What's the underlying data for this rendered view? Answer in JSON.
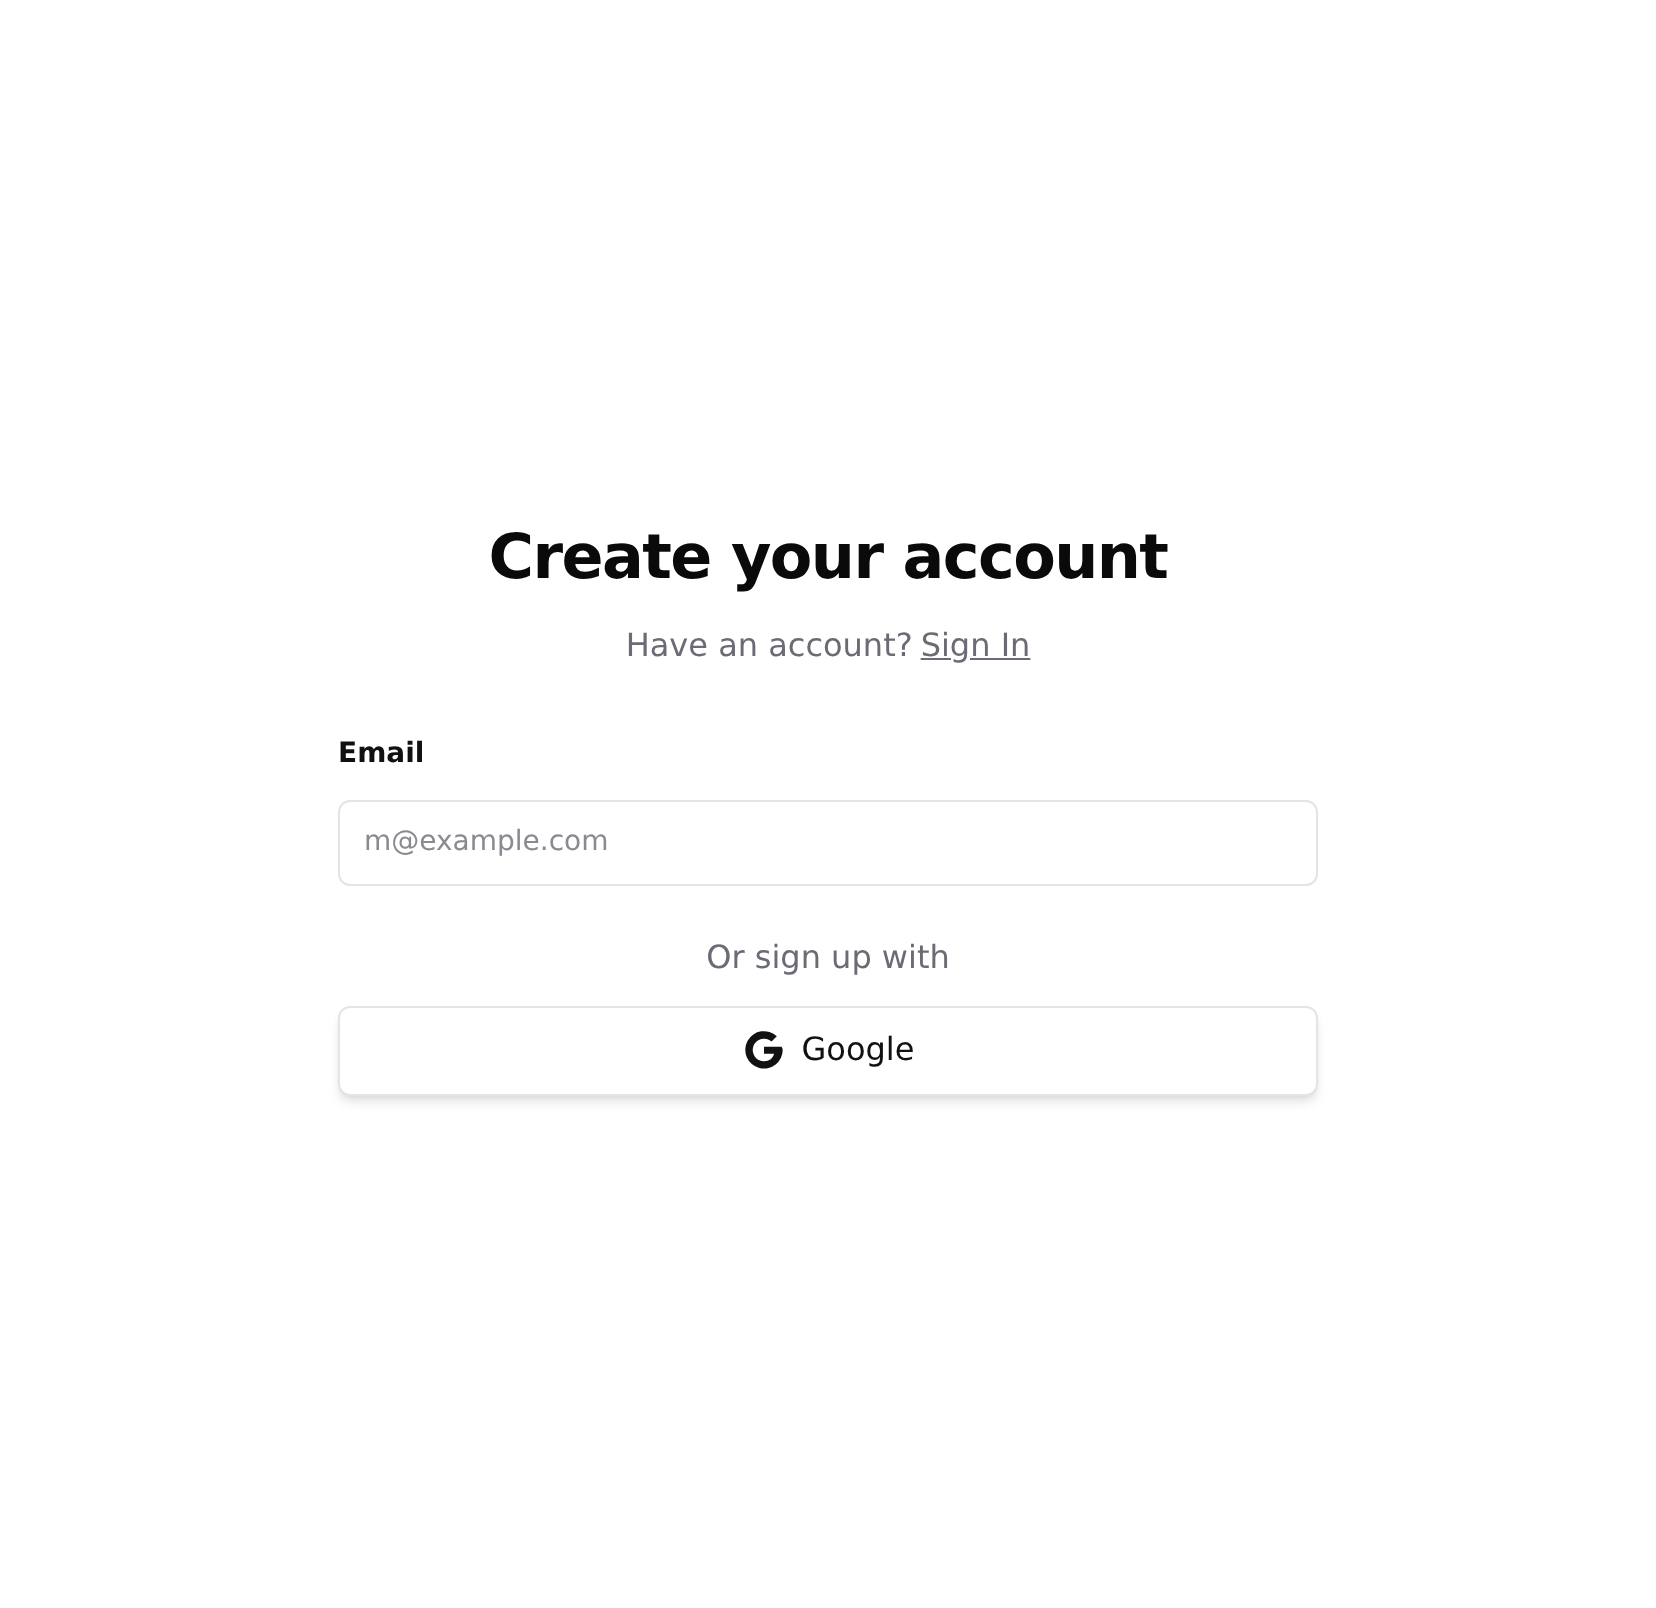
{
  "heading": "Create your account",
  "subtitle": {
    "text": "Have an account?",
    "link": "Sign In"
  },
  "email": {
    "label": "Email",
    "placeholder": "m@example.com"
  },
  "divider_text": "Or sign up with",
  "social_buttons": [
    {
      "kind": "google",
      "label": "Google"
    }
  ]
}
